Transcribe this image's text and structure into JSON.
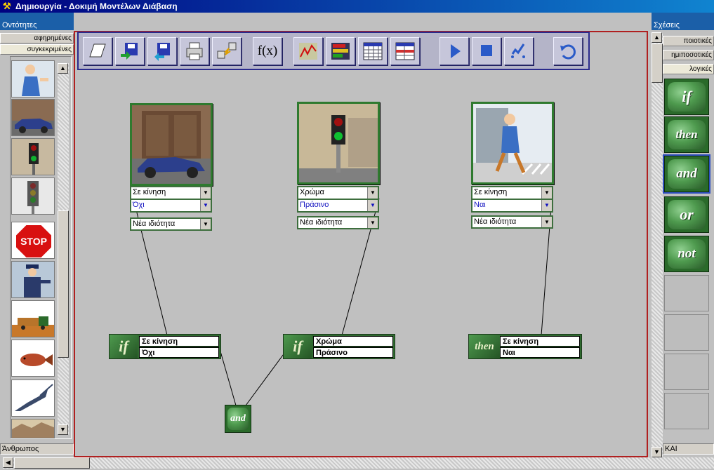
{
  "window": {
    "title": "Δημιουργία - Δοκιμή Μοντέλων Διάβαση"
  },
  "left_panel": {
    "header": "Οντότητες",
    "tabs": [
      "αφηρημένες",
      "συγκεκριμένες"
    ],
    "status": "Άνθρωπος"
  },
  "right_panel": {
    "header": "Σχέσεις",
    "tabs": [
      "ποιοτικές",
      "ημιποσοτικές",
      "λογικές"
    ],
    "logic_items": [
      "if",
      "then",
      "and",
      "or",
      "not"
    ],
    "status": "ΚΑΙ"
  },
  "toolbar": {
    "fx_label": "f(x)",
    "buttons": [
      "new-icon",
      "open-icon",
      "save-icon",
      "print-icon",
      "connect-icon",
      "function-icon",
      "graph-icon",
      "bar-chart-icon",
      "table-icon",
      "sheet-icon",
      "play-icon",
      "stop-icon",
      "check-icon",
      "undo-icon"
    ]
  },
  "entities": [
    {
      "prop1": "Σε κίνηση",
      "val1": "Όχι",
      "new_prop": "Νέα ιδιότητα"
    },
    {
      "prop1": "Χρώμα",
      "val1": "Πράσινο",
      "new_prop": "Νέα ιδιότητα"
    },
    {
      "prop1": "Σε κίνηση",
      "val1": "Ναι",
      "new_prop": "Νέα ιδιότητα"
    }
  ],
  "rules": [
    {
      "keyword": "if",
      "line1": "Σε κίνηση",
      "line2": "Όχι"
    },
    {
      "keyword": "if",
      "line1": "Χρώμα",
      "line2": "Πράσινο"
    },
    {
      "keyword": "then",
      "line1": "Σε κίνηση",
      "line2": "Ναι"
    }
  ],
  "and_node": {
    "label": "and"
  },
  "colors": {
    "title_start": "#000080",
    "workspace_border": "#b02020",
    "rule_green": "#2f6a2f"
  }
}
